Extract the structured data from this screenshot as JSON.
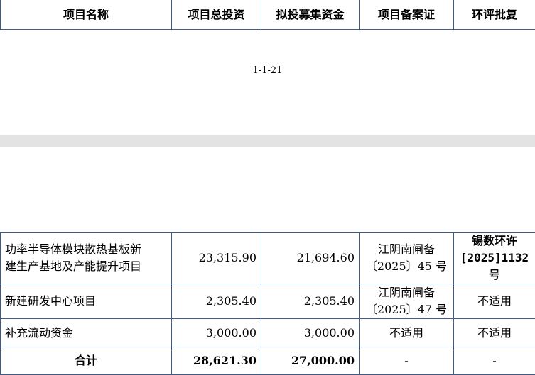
{
  "header": {
    "columns": [
      "项目名称",
      "项目总投资",
      "拟投募集资金",
      "项目备案证",
      "环评批复"
    ]
  },
  "page_number": "1-1-21",
  "rows": [
    {
      "name_line1": "功率半导体模块散热基板新",
      "name_line2": "建生产基地及产能提升项目",
      "total": "23,315.90",
      "raised": "21,694.60",
      "filing_line1": "江阴南闸备",
      "filing_line2": "〔2025〕45 号",
      "eia_line1": "锡数环许",
      "eia_line2": "[2025]1132",
      "eia_line3": "号"
    },
    {
      "name": "新建研发中心项目",
      "total": "2,305.40",
      "raised": "2,305.40",
      "filing_line1": "江阴南闸备",
      "filing_line2": "〔2025〕47 号",
      "eia": "不适用"
    },
    {
      "name": "补充流动资金",
      "total": "3,000.00",
      "raised": "3,000.00",
      "filing": "不适用",
      "eia": "不适用"
    }
  ],
  "total_row": {
    "label": "合计",
    "total": "28,621.30",
    "raised": "27,000.00",
    "filing": "-",
    "eia": "-"
  }
}
